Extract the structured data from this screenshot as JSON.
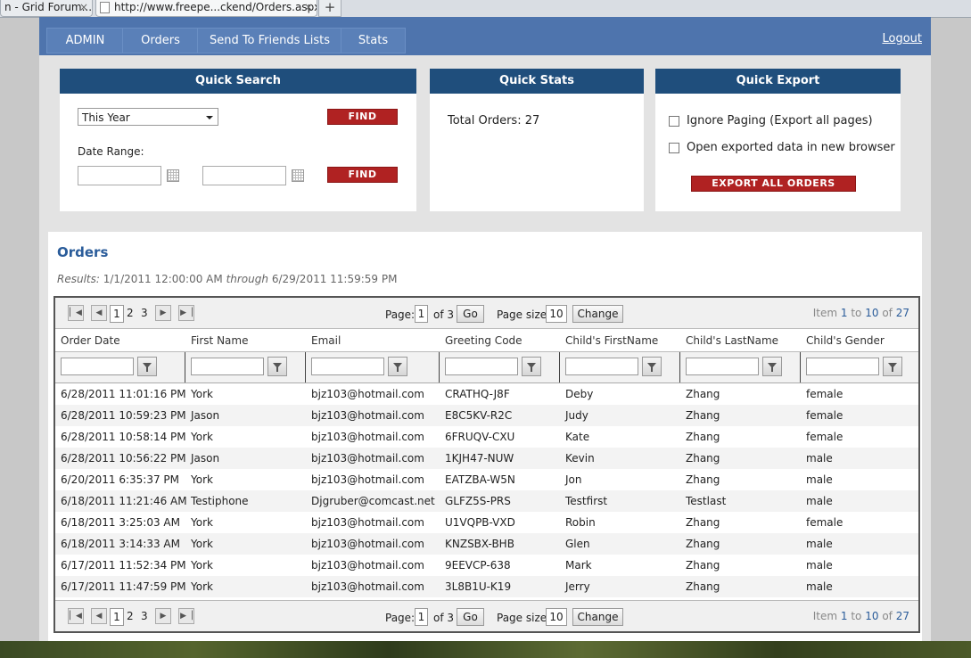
{
  "browser": {
    "tabs": [
      {
        "title": "n - Grid Forum...",
        "close": "×"
      },
      {
        "title": "http://www.freepe...ckend/Orders.aspx",
        "close": "×"
      }
    ],
    "new_tab": "+"
  },
  "nav": {
    "items": [
      "ADMIN",
      "Orders",
      "Send To Friends Lists",
      "Stats"
    ],
    "logout": "Logout"
  },
  "quick_search": {
    "title": "Quick Search",
    "period": "This Year",
    "find": "FIND",
    "date_range_label": "Date Range:"
  },
  "quick_stats": {
    "title": "Quick Stats",
    "total_orders": "Total Orders: 27"
  },
  "quick_export": {
    "title": "Quick Export",
    "option1": "Ignore Paging (Export all pages)",
    "option2": "Open exported data in new browser",
    "export_button": "EXPORT ALL ORDERS"
  },
  "orders": {
    "title": "Orders",
    "results_label": "Results:",
    "results_from": "1/1/2011 12:00:00 AM",
    "results_through": "through",
    "results_to": "6/29/2011 11:59:59 PM"
  },
  "pager": {
    "pages": [
      "1",
      "2",
      "3"
    ],
    "page_label": "Page:",
    "page_value": "1",
    "of_label": "of 3",
    "go": "Go",
    "page_size_label": "Page size:",
    "page_size_value": "10",
    "change": "Change",
    "item_word": "Item",
    "item_from": "1",
    "to_word": "to",
    "item_to": "10",
    "of_word": "of",
    "item_total": "27"
  },
  "columns": [
    "Order Date",
    "First Name",
    "Email",
    "Greeting Code",
    "Child's FirstName",
    "Child's LastName",
    "Child's Gender"
  ],
  "rows": [
    [
      "6/28/2011 11:01:16 PM",
      "York",
      "bjz103@hotmail.com",
      "CRATHQ-J8F",
      "Deby",
      "Zhang",
      "female"
    ],
    [
      "6/28/2011 10:59:23 PM",
      "Jason",
      "bjz103@hotmail.com",
      "E8C5KV-R2C",
      "Judy",
      "Zhang",
      "female"
    ],
    [
      "6/28/2011 10:58:14 PM",
      "York",
      "bjz103@hotmail.com",
      "6FRUQV-CXU",
      "Kate",
      "Zhang",
      "female"
    ],
    [
      "6/28/2011 10:56:22 PM",
      "Jason",
      "bjz103@hotmail.com",
      "1KJH47-NUW",
      "Kevin",
      "Zhang",
      "male"
    ],
    [
      "6/20/2011 6:35:37 PM",
      "York",
      "bjz103@hotmail.com",
      "EATZBA-W5N",
      "Jon",
      "Zhang",
      "male"
    ],
    [
      "6/18/2011 11:21:46 AM",
      "Testiphone",
      "Djgruber@comcast.net",
      "GLFZ5S-PRS",
      "Testfirst",
      "Testlast",
      "male"
    ],
    [
      "6/18/2011 3:25:03 AM",
      "York",
      "bjz103@hotmail.com",
      "U1VQPB-VXD",
      "Robin",
      "Zhang",
      "female"
    ],
    [
      "6/18/2011 3:14:33 AM",
      "York",
      "bjz103@hotmail.com",
      "KNZSBX-BHB",
      "Glen",
      "Zhang",
      "male"
    ],
    [
      "6/17/2011 11:52:34 PM",
      "York",
      "bjz103@hotmail.com",
      "9EEVCP-638",
      "Mark",
      "Zhang",
      "male"
    ],
    [
      "6/17/2011 11:47:59 PM",
      "York",
      "bjz103@hotmail.com",
      "3L8B1U-K19",
      "Jerry",
      "Zhang",
      "male"
    ]
  ],
  "colors": {
    "nav": "#4e74ad",
    "panel_header": "#1f4e7c",
    "button_red": "#b02222",
    "title_blue": "#2a5c9a"
  }
}
